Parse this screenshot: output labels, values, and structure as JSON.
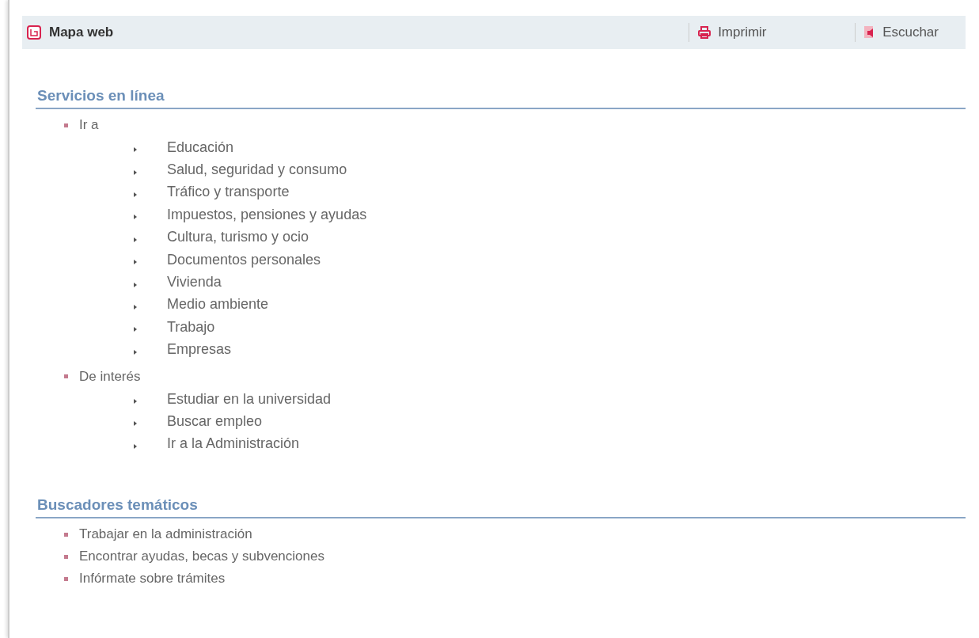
{
  "header": {
    "title": "Mapa web",
    "actions": [
      {
        "label": "Imprimir",
        "kind": "print"
      },
      {
        "label": "Escuchar",
        "kind": "listen"
      }
    ]
  },
  "sections": [
    {
      "title": "Servicios en línea",
      "items": [
        {
          "label": "Ir a",
          "children": [
            {
              "label": "Educación"
            },
            {
              "label": "Salud, seguridad y consumo"
            },
            {
              "label": "Tráfico y transporte"
            },
            {
              "label": "Impuestos, pensiones y ayudas"
            },
            {
              "label": "Cultura, turismo y ocio"
            },
            {
              "label": "Documentos personales"
            },
            {
              "label": "Vivienda"
            },
            {
              "label": "Medio ambiente"
            },
            {
              "label": "Trabajo"
            },
            {
              "label": "Empresas"
            }
          ]
        },
        {
          "label": "De interés",
          "children": [
            {
              "label": "Estudiar en la universidad"
            },
            {
              "label": "Buscar empleo"
            },
            {
              "label": "Ir a la Administración"
            }
          ]
        }
      ]
    },
    {
      "title": "Buscadores temáticos",
      "items": [
        {
          "label": "Trabajar en la administración"
        },
        {
          "label": "Encontrar ayudas, becas y subvenciones"
        },
        {
          "label": "Infórmate sobre trámites"
        }
      ]
    }
  ]
}
